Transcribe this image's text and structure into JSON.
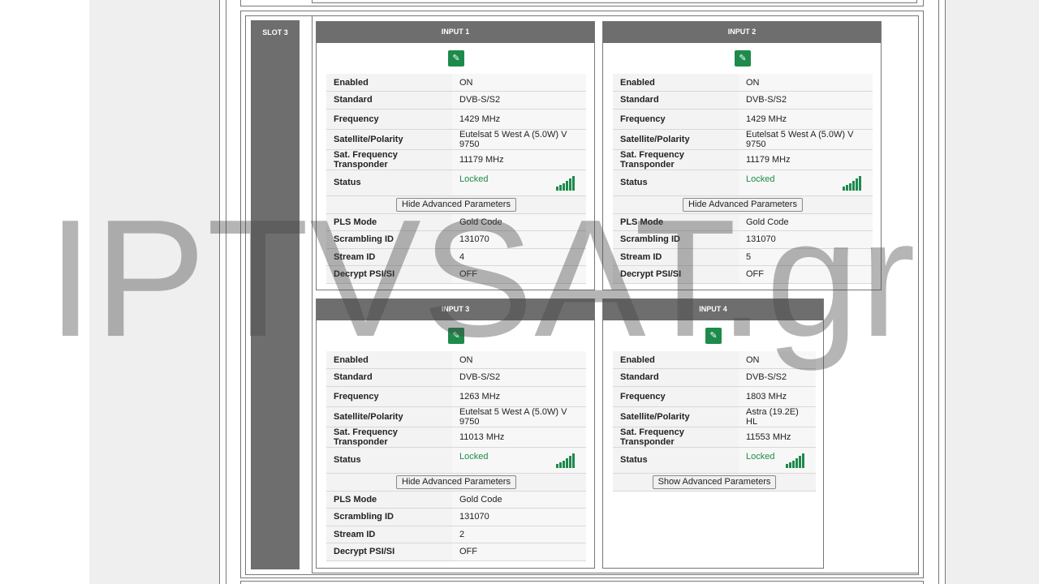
{
  "slot": {
    "label": "SLOT 3"
  },
  "colors": {
    "header": "#6e6e6e",
    "accent_green": "#1e8a4c",
    "page_bg": "#efefef"
  },
  "icons": {
    "edit": "pencil-icon",
    "signal": "signal-bars-icon"
  },
  "watermark": "IPTVSAT.gr",
  "inputs": [
    {
      "title": "INPUT 1",
      "rows": [
        {
          "key": "Enabled",
          "value": "ON"
        },
        {
          "key": "Standard",
          "value": "DVB-S/S2"
        },
        {
          "key": "Frequency",
          "value": "1429 MHz"
        },
        {
          "key": "Satellite/Polarity",
          "value": "Eutelsat 5 West A (5.0W) V 9750"
        },
        {
          "key": "Sat. Frequency Transponder",
          "value": "11179 MHz"
        }
      ],
      "status": {
        "key": "Status",
        "value": "Locked"
      },
      "adv_button": "Hide Advanced Parameters",
      "advanced": [
        {
          "key": "PLS Mode",
          "value": "Gold Code"
        },
        {
          "key": "Scrambling ID",
          "value": "131070"
        },
        {
          "key": "Stream ID",
          "value": "4"
        },
        {
          "key": "Decrypt PSI/SI",
          "value": "OFF"
        }
      ]
    },
    {
      "title": "INPUT 2",
      "rows": [
        {
          "key": "Enabled",
          "value": "ON"
        },
        {
          "key": "Standard",
          "value": "DVB-S/S2"
        },
        {
          "key": "Frequency",
          "value": "1429 MHz"
        },
        {
          "key": "Satellite/Polarity",
          "value": "Eutelsat 5 West A (5.0W) V 9750"
        },
        {
          "key": "Sat. Frequency Transponder",
          "value": "11179 MHz"
        }
      ],
      "status": {
        "key": "Status",
        "value": "Locked"
      },
      "adv_button": "Hide Advanced Parameters",
      "advanced": [
        {
          "key": "PLS Mode",
          "value": "Gold Code"
        },
        {
          "key": "Scrambling ID",
          "value": "131070"
        },
        {
          "key": "Stream ID",
          "value": "5"
        },
        {
          "key": "Decrypt PSI/SI",
          "value": "OFF"
        }
      ]
    },
    {
      "title": "INPUT 3",
      "rows": [
        {
          "key": "Enabled",
          "value": "ON"
        },
        {
          "key": "Standard",
          "value": "DVB-S/S2"
        },
        {
          "key": "Frequency",
          "value": "1263 MHz"
        },
        {
          "key": "Satellite/Polarity",
          "value": "Eutelsat 5 West A (5.0W) V 9750"
        },
        {
          "key": "Sat. Frequency Transponder",
          "value": "11013 MHz"
        }
      ],
      "status": {
        "key": "Status",
        "value": "Locked"
      },
      "adv_button": "Hide Advanced Parameters",
      "advanced": [
        {
          "key": "PLS Mode",
          "value": "Gold Code"
        },
        {
          "key": "Scrambling ID",
          "value": "131070"
        },
        {
          "key": "Stream ID",
          "value": "2"
        },
        {
          "key": "Decrypt PSI/SI",
          "value": "OFF"
        }
      ]
    },
    {
      "title": "INPUT 4",
      "rows": [
        {
          "key": "Enabled",
          "value": "ON"
        },
        {
          "key": "Standard",
          "value": "DVB-S/S2"
        },
        {
          "key": "Frequency",
          "value": "1803 MHz"
        },
        {
          "key": "Satellite/Polarity",
          "value": "Astra (19.2E) HL"
        },
        {
          "key": "Sat. Frequency Transponder",
          "value": "11553 MHz"
        }
      ],
      "status": {
        "key": "Status",
        "value": "Locked"
      },
      "adv_button": "Show Advanced Parameters",
      "advanced": []
    }
  ]
}
